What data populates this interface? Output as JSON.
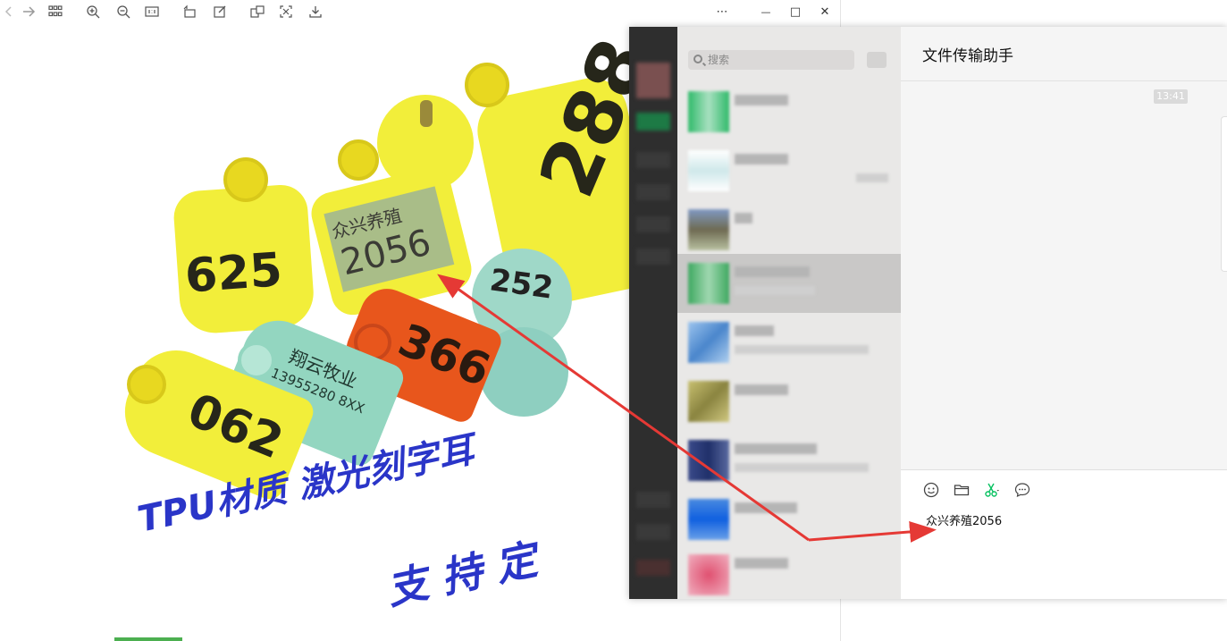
{
  "viewer": {
    "tags": {
      "t625": "625",
      "t2056_line1": "众兴养殖",
      "t2056_line2": "2056",
      "t288": "288",
      "t252": "252",
      "t366": "366",
      "t062": "062",
      "teal_line1": "翔云牧业",
      "teal_line2": "13955280 8XX"
    },
    "slogan": {
      "line1": "TPU材质  激光刻字耳",
      "line2": "支  持  定"
    }
  },
  "window_controls": {
    "more": "⋯",
    "minimize": "—",
    "maximize": "□",
    "close": "✕"
  },
  "wechat": {
    "search_placeholder": "搜索",
    "chat_title": "文件传输助手",
    "time_chip": "13:41",
    "input_text": "众兴养殖2056",
    "colors": {
      "accent_green": "#07c160",
      "annotation_red": "#e53935"
    }
  }
}
